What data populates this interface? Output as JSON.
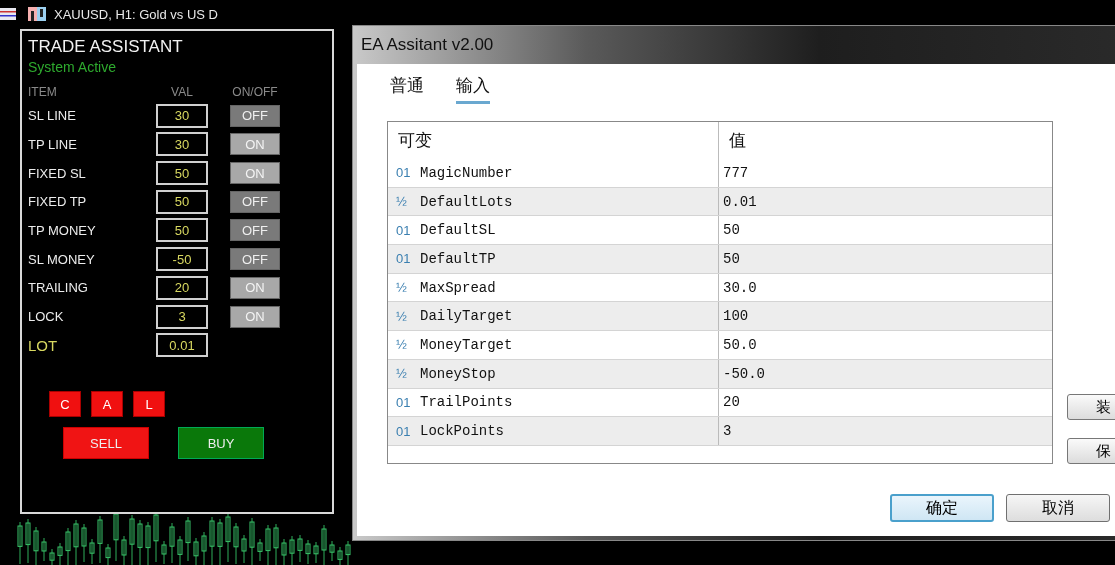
{
  "chart": {
    "title": "XAUUSD, H1:  Gold vs US D"
  },
  "panel": {
    "title": "TRADE ASSISTANT",
    "status": "System Active",
    "columns": [
      "ITEM",
      "VAL",
      "ON/OFF"
    ],
    "rows": [
      {
        "label": "SL LINE",
        "value": "30",
        "toggle": "OFF",
        "on": false
      },
      {
        "label": "TP LINE",
        "value": "30",
        "toggle": "ON",
        "on": true
      },
      {
        "label": "FIXED SL",
        "value": "50",
        "toggle": "ON",
        "on": true
      },
      {
        "label": "FIXED TP",
        "value": "50",
        "toggle": "OFF",
        "on": false
      },
      {
        "label": "TP MONEY",
        "value": "50",
        "toggle": "OFF",
        "on": false
      },
      {
        "label": "SL MONEY",
        "value": "-50",
        "toggle": "OFF",
        "on": false
      },
      {
        "label": "TRAILING",
        "value": "20",
        "toggle": "ON",
        "on": true
      },
      {
        "label": "LOCK",
        "value": "3",
        "toggle": "ON",
        "on": true
      },
      {
        "label": "LOT",
        "value": "0.01"
      }
    ],
    "small_buttons": [
      "C",
      "A",
      "L"
    ],
    "sell": "SELL",
    "buy": "BUY"
  },
  "dialog": {
    "title": "EA Assitant v2.00",
    "tabs": [
      {
        "label": "普通",
        "selected": false
      },
      {
        "label": "输入",
        "selected": true
      }
    ],
    "table": {
      "columns": [
        "可变",
        "值"
      ],
      "rows": [
        {
          "type": "01",
          "name": "MagicNumber",
          "value": "777"
        },
        {
          "type": "½",
          "name": "DefaultLots",
          "value": "0.01"
        },
        {
          "type": "01",
          "name": "DefaultSL",
          "value": "50"
        },
        {
          "type": "01",
          "name": "DefaultTP",
          "value": "50"
        },
        {
          "type": "½",
          "name": "MaxSpread",
          "value": "30.0"
        },
        {
          "type": "½",
          "name": "DailyTarget",
          "value": "100"
        },
        {
          "type": "½",
          "name": "MoneyTarget",
          "value": "50.0"
        },
        {
          "type": "½",
          "name": "MoneyStop",
          "value": "-50.0"
        },
        {
          "type": "01",
          "name": "TrailPoints",
          "value": "20"
        },
        {
          "type": "01",
          "name": "LockPoints",
          "value": "3"
        }
      ]
    },
    "side_buttons": [
      "装",
      "保"
    ],
    "buttons": [
      {
        "label": "确定",
        "default": true
      },
      {
        "label": "取消",
        "default": false
      }
    ]
  }
}
